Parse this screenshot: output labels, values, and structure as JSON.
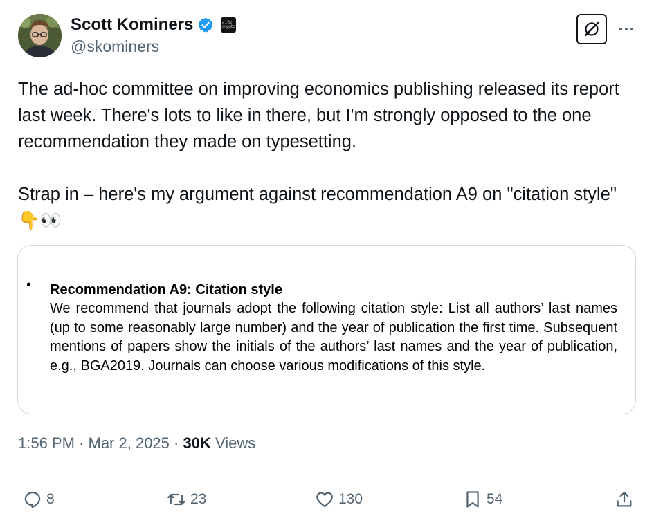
{
  "author": {
    "display_name": "Scott Kominers",
    "handle": "@skominers",
    "verified": true,
    "affiliation_badge_icon": "a16z-crypto-logo"
  },
  "header_actions": {
    "grok_icon": "grok-icon",
    "more_icon": "more-horizontal-icon"
  },
  "tweet": {
    "text": "The ad-hoc committee on improving economics publishing released its report last week. There's lots to like in there, but I'm strongly opposed to the one recommendation they made on typesetting.\n\nStrap in – here's my argument against recommendation A9 on \"citation style\" 👇👀"
  },
  "media": {
    "bullet": "•",
    "title": "Recommendation A9: Citation style",
    "body": "We recommend that journals adopt the following citation style: List all authors’ last names (up to some reasonably large number) and the year of publication the first time. Subsequent mentions of papers show the initials of the authors’ last names and the year of publication, e.g., BGA2019. Journals can choose various modifications of this style."
  },
  "meta": {
    "time": "1:56 PM",
    "separator1": " · ",
    "date": "Mar 2, 2025",
    "separator2": " · ",
    "views_count": "30K",
    "views_label": " Views"
  },
  "actions": {
    "replies": "8",
    "reposts": "23",
    "likes": "130",
    "bookmarks": "54"
  },
  "colors": {
    "text": "#0f1419",
    "secondary": "#536471",
    "verified": "#1d9bf0",
    "border": "#cfd9de"
  }
}
